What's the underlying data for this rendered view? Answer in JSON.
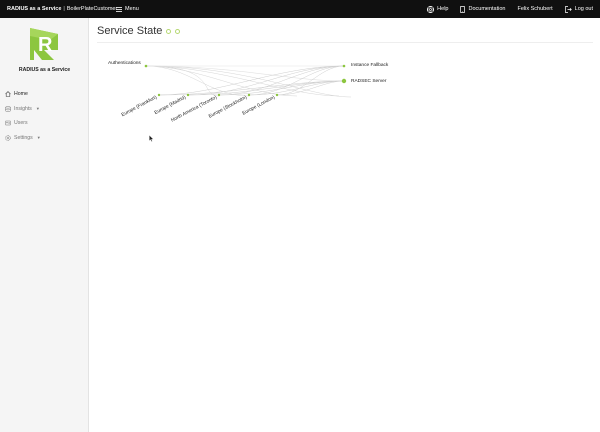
{
  "header": {
    "brand_bold": "RADIUS as a Service",
    "brand_sep": "|",
    "brand_customer": "BoilerPlateCustomer",
    "menu_label": "Menu",
    "help_label": "Help",
    "docs_label": "Documentation",
    "user_name": "Felix Schubert",
    "logout_label": "Log out"
  },
  "sidebar": {
    "logo_letter": "R",
    "app_name": "RADIUS as a Service",
    "items": [
      {
        "label": "Home",
        "icon": "home-icon",
        "active": true,
        "dropdown": false
      },
      {
        "label": "Insights",
        "icon": "insights-icon",
        "active": false,
        "dropdown": true
      },
      {
        "label": "Users",
        "icon": "users-icon",
        "active": false,
        "dropdown": false
      },
      {
        "label": "Settings",
        "icon": "settings-icon",
        "active": false,
        "dropdown": true
      }
    ]
  },
  "main": {
    "title": "Service State"
  },
  "graph": {
    "source": "Authentications",
    "regions": [
      "Europe (Frankfurt)",
      "Europe (Madrid)",
      "North America (Toronto)",
      "Europe (Stockholm)",
      "Europe (London)"
    ],
    "targets": [
      "Instance Fallback",
      "RADSEC Server"
    ]
  },
  "colors": {
    "accent": "#8cc63f",
    "topbar_bg": "#101010",
    "sidebar_bg": "#f5f5f5"
  }
}
